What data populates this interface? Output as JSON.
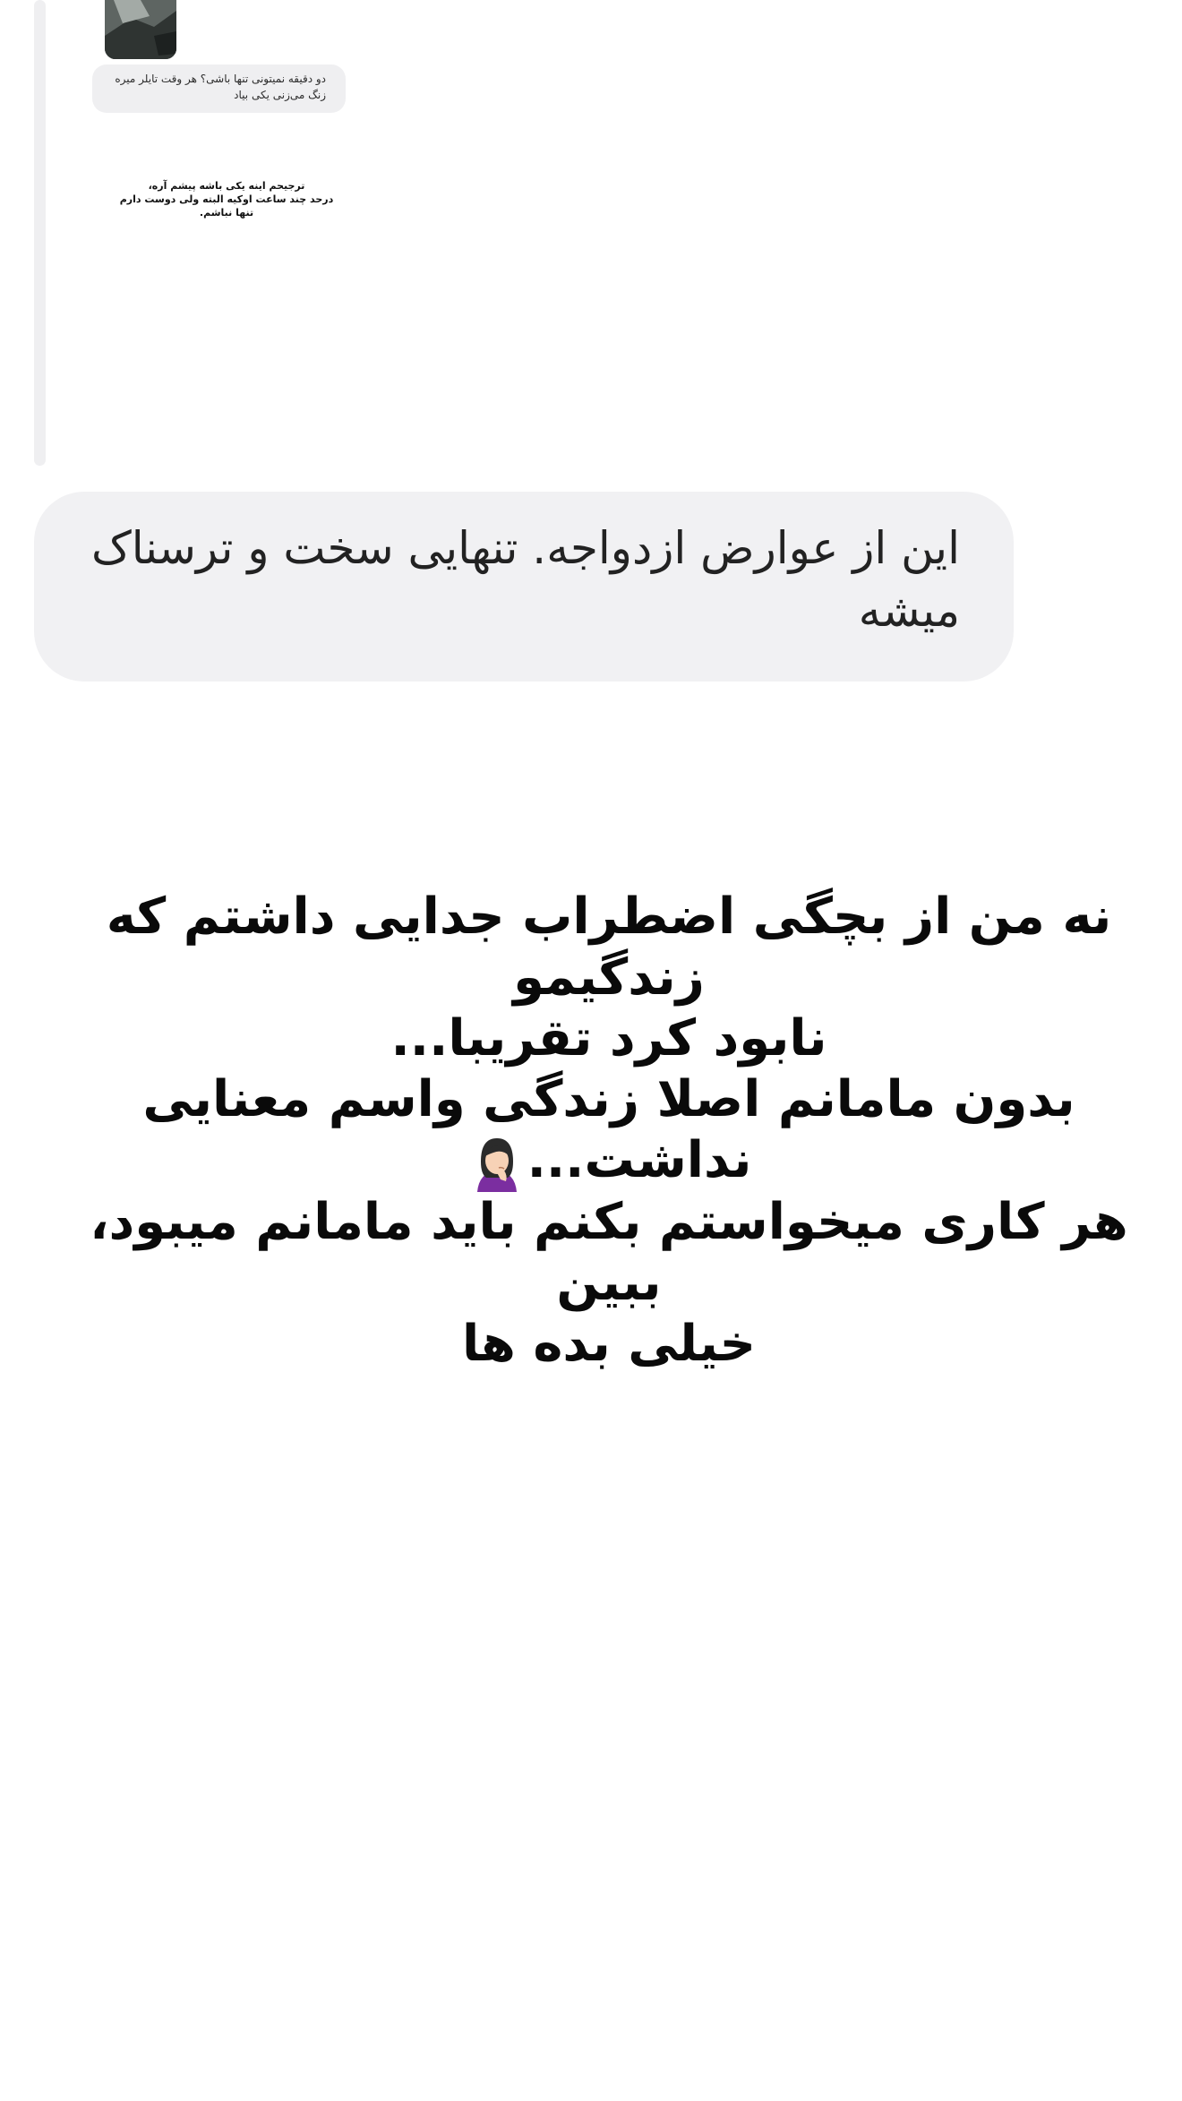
{
  "reply_preview": {
    "caption": "دو دقیقه نمیتونی تنها باشی؟ هر وقت تایلر میره\nزنگ می‌زنی یکی بیاد",
    "story_text": "ترجیحم اینه یکی باشه پیشم آره،\nدرحد چند ساعت اوکیه البته ولی دوست دارم\nتنها نباشم."
  },
  "message": {
    "text": "این از عوارض ازدواجه. تنهایی سخت و ترسناک میشه"
  },
  "story": {
    "line1": "نه من از بچگی اضطراب جدایی داشتم که زندگیمو",
    "line2": "نابود کرد تقریبا...",
    "line3": "بدون مامانم اصلا زندگی واسم معنایی نداشت...",
    "line4": "هر کاری میخواستم بکنم باید مامانم میبود، ببین",
    "line5": "خیلی بده ها",
    "emoji_icon": "woman-facepalming-icon"
  }
}
